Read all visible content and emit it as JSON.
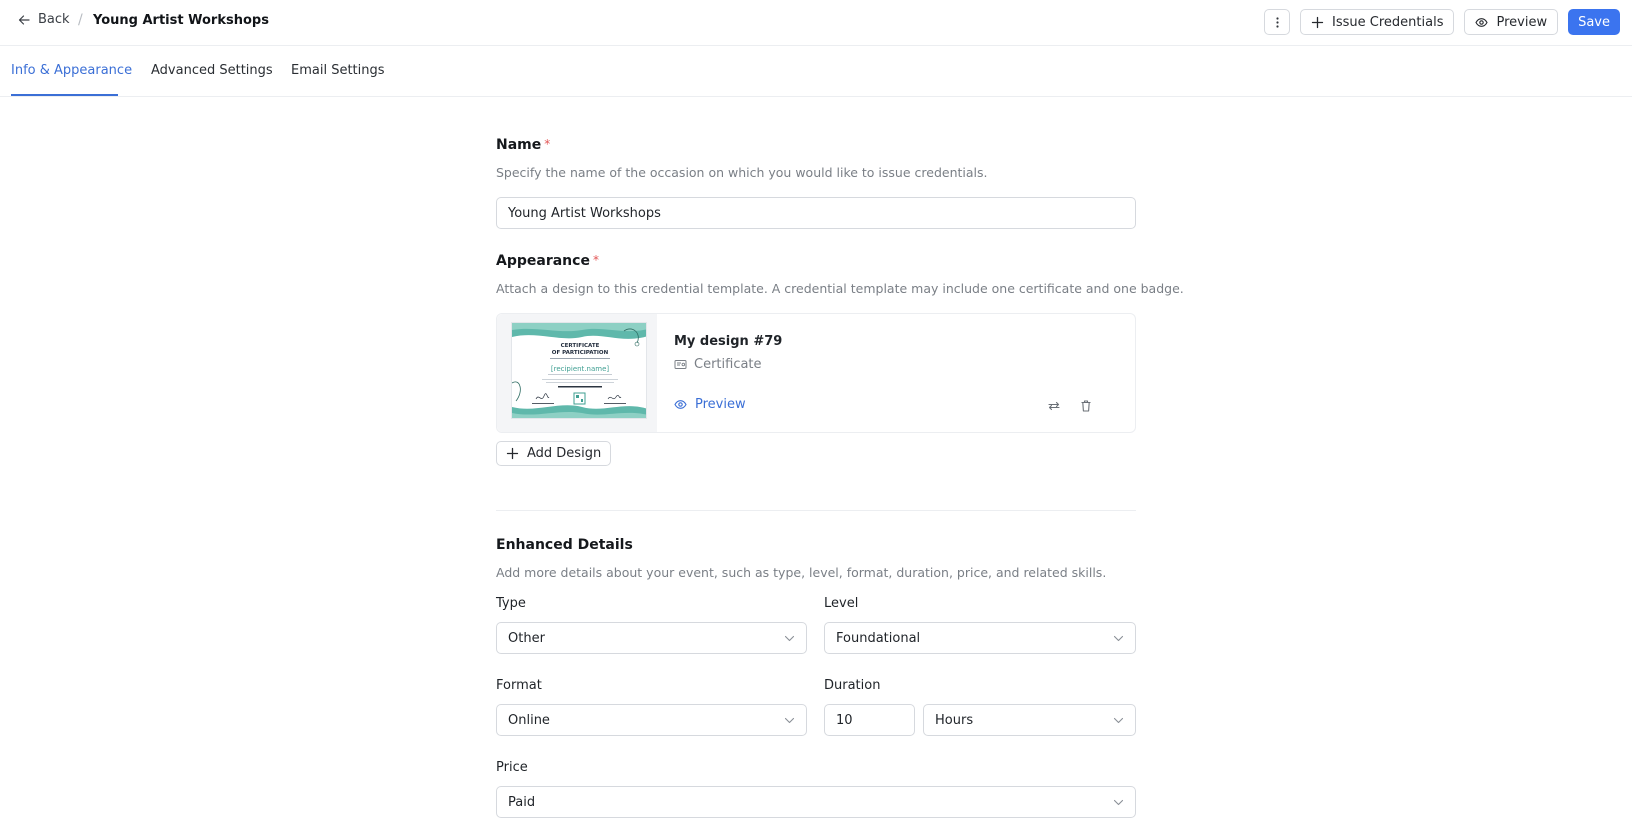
{
  "header": {
    "back_label": "Back",
    "separator": "/",
    "title": "Young Artist Workshops",
    "issue_label": "Issue Credentials",
    "preview_label": "Preview",
    "save_label": "Save"
  },
  "tabs": [
    {
      "label": "Info & Appearance",
      "active": true
    },
    {
      "label": "Advanced Settings",
      "active": false
    },
    {
      "label": "Email Settings",
      "active": false
    }
  ],
  "name_section": {
    "label": "Name",
    "required_mark": "*",
    "help": "Specify the name of the occasion on which you would like to issue credentials.",
    "value": "Young Artist Workshops"
  },
  "appearance_section": {
    "label": "Appearance",
    "required_mark": "*",
    "help": "Attach a design to this credential template. A credential template may include one certificate and one badge.",
    "design": {
      "name": "My design #79",
      "type": "Certificate",
      "preview_label": "Preview",
      "thumbnail": {
        "heading_line1": "CERTIFICATE",
        "heading_line2": "OF PARTICIPATION",
        "recipient": "[recipient.name]"
      }
    },
    "add_design_label": "Add Design"
  },
  "enhanced_section": {
    "label": "Enhanced Details",
    "help": "Add more details about your event, such as type, level, format, duration, price, and related skills.",
    "type": {
      "label": "Type",
      "value": "Other"
    },
    "level": {
      "label": "Level",
      "value": "Foundational"
    },
    "format": {
      "label": "Format",
      "value": "Online"
    },
    "duration": {
      "label": "Duration",
      "value": "10",
      "unit": "Hours"
    },
    "price": {
      "label": "Price",
      "value": "Paid"
    }
  },
  "colors": {
    "accent": "#3b74ef",
    "tab_active": "#3b6fd6",
    "required": "#e25555",
    "thumbnail_teal": "#5fb8ab"
  }
}
